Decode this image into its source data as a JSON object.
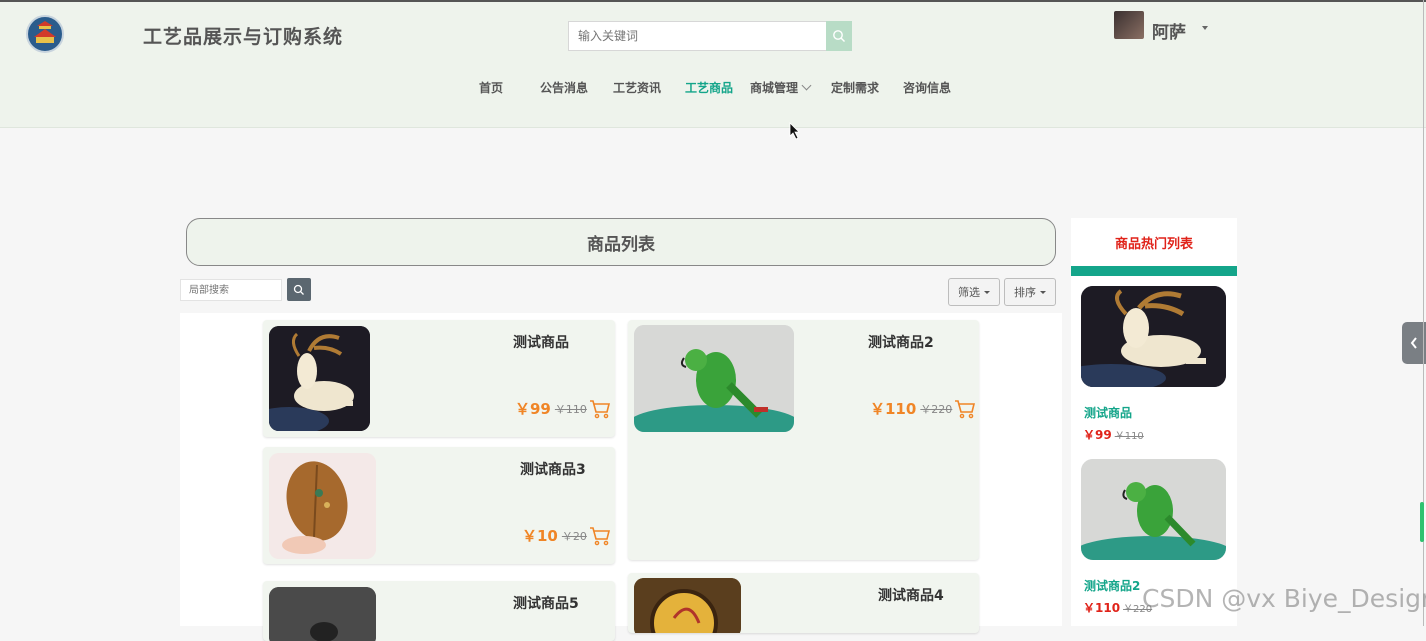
{
  "header": {
    "site_title": "工艺品展示与订购系统",
    "search_placeholder": "输入关键词",
    "user_name": "阿萨"
  },
  "nav": {
    "items": [
      {
        "label": "首页",
        "active": false
      },
      {
        "label": "公告消息",
        "active": false
      },
      {
        "label": "工艺资讯",
        "active": false
      },
      {
        "label": "工艺商品",
        "active": true
      },
      {
        "label": "商城管理",
        "active": false,
        "has_dropdown": true
      },
      {
        "label": "定制需求",
        "active": false
      },
      {
        "label": "咨询信息",
        "active": false
      }
    ]
  },
  "product_list": {
    "title": "商品列表",
    "local_search_placeholder": "局部搜索",
    "filter_label": "筛选",
    "sort_label": "排序",
    "products": [
      {
        "name": "测试商品",
        "price": "￥99",
        "old_price": "￥110",
        "image": "deer-sculpture"
      },
      {
        "name": "测试商品2",
        "price": "￥110",
        "old_price": "￥220",
        "image": "parrot-sculpture"
      },
      {
        "name": "测试商品3",
        "price": "￥10",
        "old_price": "￥20",
        "image": "leaf-painting"
      },
      {
        "name": "测试商品5",
        "image": "dark-vase"
      },
      {
        "name": "测试商品4",
        "image": "round-embroidery"
      }
    ]
  },
  "hot_list": {
    "title": "商品热门列表",
    "items": [
      {
        "name": "测试商品",
        "price": "￥99",
        "old_price": "￥110",
        "image": "deer-sculpture"
      },
      {
        "name": "测试商品2",
        "price": "￥110",
        "old_price": "￥220",
        "image": "parrot-sculpture"
      }
    ]
  },
  "watermark": "CSDN @vx Biye_Design",
  "colors": {
    "accent": "#14a58a",
    "price": "#f08526",
    "hot_price": "#e0231a",
    "header_bg": "#eef3ec"
  }
}
